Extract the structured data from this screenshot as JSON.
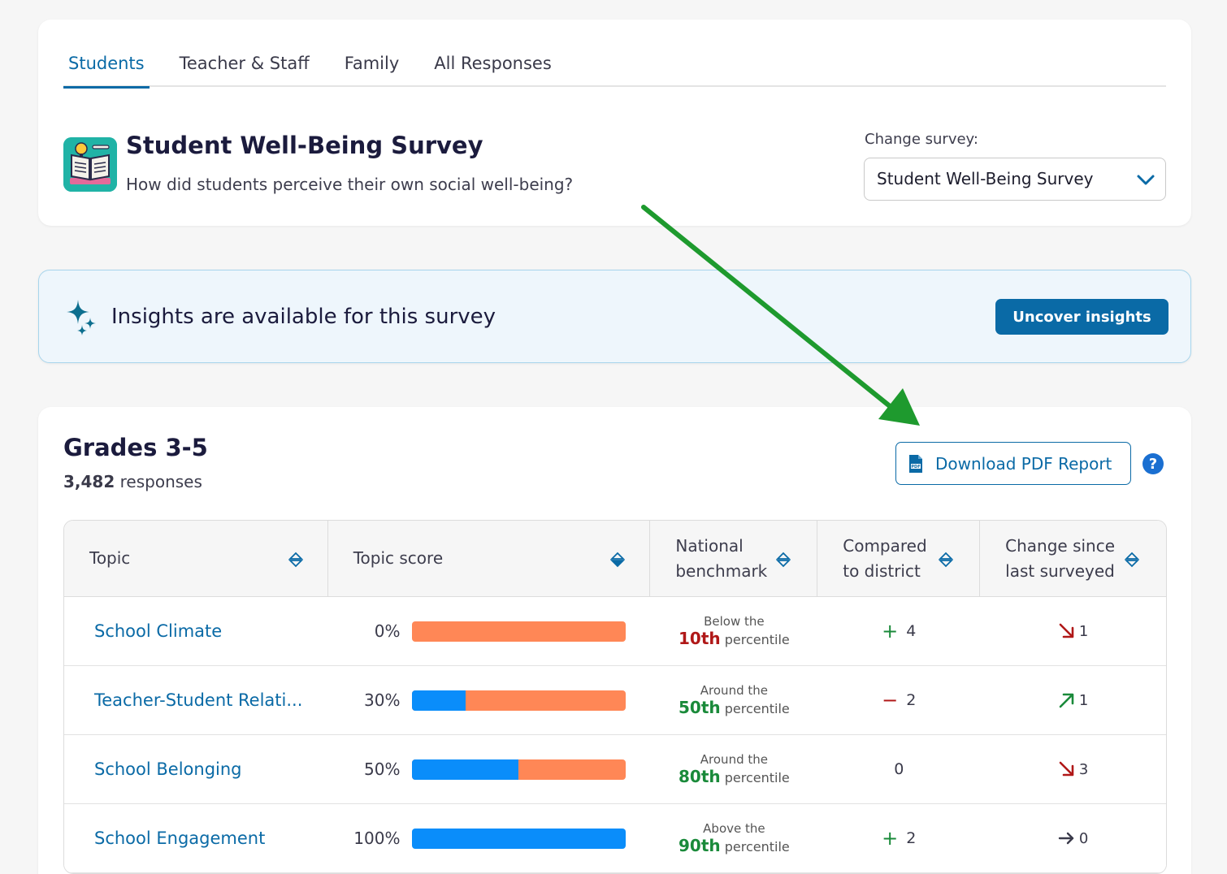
{
  "tabs": [
    {
      "label": "Students",
      "active": true
    },
    {
      "label": "Teacher & Staff",
      "active": false
    },
    {
      "label": "Family",
      "active": false
    },
    {
      "label": "All Responses",
      "active": false
    }
  ],
  "survey": {
    "title": "Student Well-Being Survey",
    "subtitle": "How did students perceive their own social well-being?",
    "change_label": "Change survey:",
    "selected": "Student Well-Being Survey"
  },
  "insights": {
    "text": "Insights are available for this survey",
    "button": "Uncover insights"
  },
  "results": {
    "grade": "Grades 3-5",
    "responses_count": "3,482",
    "responses_label": "responses",
    "download_button": "Download PDF Report",
    "help": "?",
    "headers": {
      "topic": "Topic",
      "score": "Topic score",
      "benchmark": "National benchmark",
      "district": "Compared to district",
      "change": "Change since last surveyed"
    },
    "rows": [
      {
        "topic": "School Climate",
        "score": "0%",
        "score_fraction": 0.0,
        "bench_prefix": "Below the",
        "bench_pct": "10th",
        "bench_color": "red",
        "bench_suffix": "percentile",
        "district_sign": "+",
        "district_value": "4",
        "change_dir": "down",
        "change_value": "1"
      },
      {
        "topic": "Teacher-Student Relati...",
        "score": "30%",
        "score_fraction": 0.25,
        "bench_prefix": "Around the",
        "bench_pct": "50th",
        "bench_color": "green",
        "bench_suffix": "percentile",
        "district_sign": "−",
        "district_value": "2",
        "change_dir": "up",
        "change_value": "1"
      },
      {
        "topic": "School Belonging",
        "score": "50%",
        "score_fraction": 0.5,
        "bench_prefix": "Around the",
        "bench_pct": "80th",
        "bench_color": "green",
        "bench_suffix": "percentile",
        "district_sign": "",
        "district_value": "0",
        "change_dir": "down",
        "change_value": "3"
      },
      {
        "topic": "School Engagement",
        "score": "100%",
        "score_fraction": 1.0,
        "bench_prefix": "Above the",
        "bench_pct": "90th",
        "bench_color": "green",
        "bench_suffix": "percentile",
        "district_sign": "+",
        "district_value": "2",
        "change_dir": "flat",
        "change_value": "0"
      }
    ]
  },
  "colors": {
    "accent": "#0a6aa6",
    "bar_positive": "#0a8dfa",
    "bar_negative": "#ff8756",
    "annotation_arrow": "#1e9a2e"
  }
}
